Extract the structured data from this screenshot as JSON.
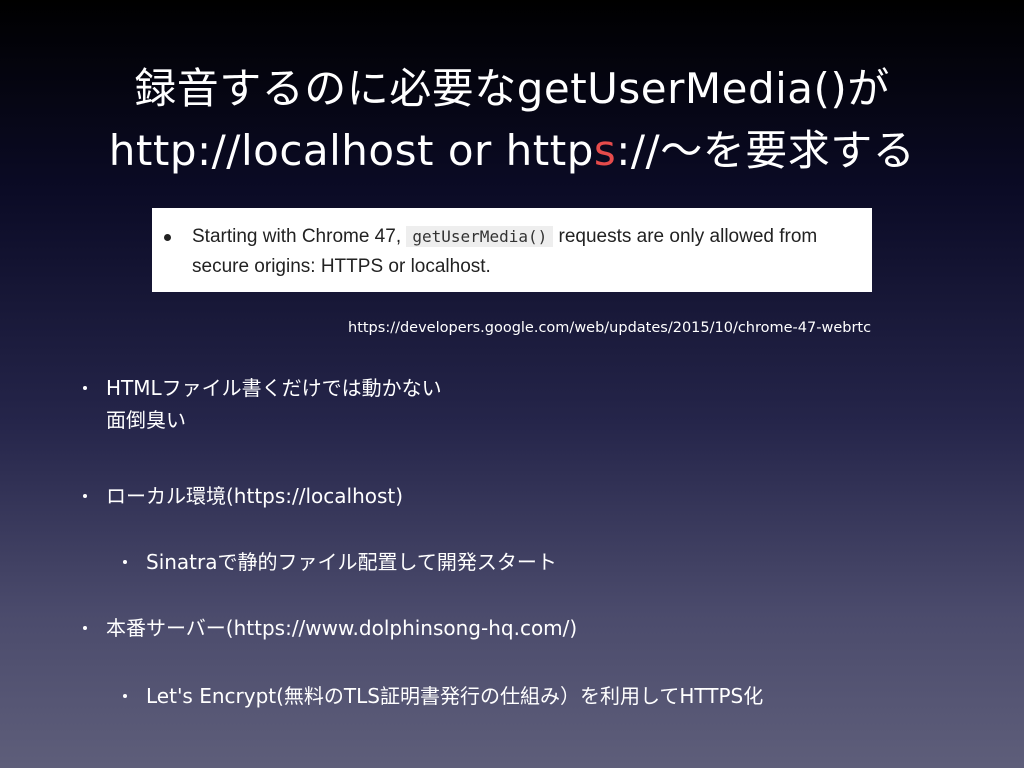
{
  "slide": {
    "title_line1": "録音するのに必要なgetUserMedia()が",
    "title_line2_pre": "http://localhost or http",
    "title_line2_accent": "s",
    "title_line2_post": "://〜を要求する",
    "quote": {
      "text_before": "Starting with Chrome 47, ",
      "code": "getUserMedia()",
      "text_after": " requests are only allowed from secure origins: HTTPS or localhost."
    },
    "source_url": "https://developers.google.com/web/updates/2015/10/chrome-47-webrtc",
    "bullets": [
      {
        "line1": "HTMLファイル書くだけでは動かない",
        "line2": "面倒臭い"
      },
      {
        "text": "ローカル環境(https://localhost)"
      },
      {
        "text": "Sinatraで静的ファイル配置して開発スタート"
      },
      {
        "text": "本番サーバー(https://www.dolphinsong-hq.com/)"
      },
      {
        "text": "Let's Encrypt(無料のTLS証明書発行の仕組み）を利用してHTTPS化"
      }
    ]
  },
  "colors": {
    "accent": "#e64b4b",
    "text": "#ffffff",
    "quote_bg": "#ffffff"
  }
}
